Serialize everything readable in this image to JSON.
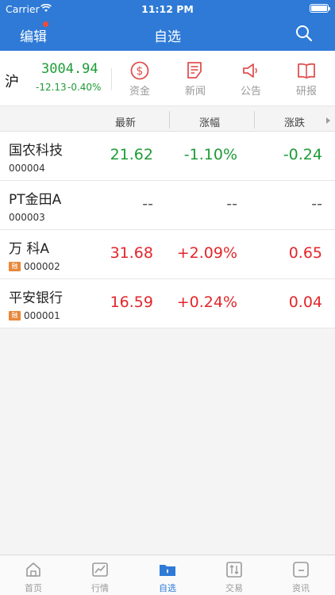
{
  "status_bar": {
    "carrier": "Carrier",
    "time": "11:12 PM"
  },
  "nav": {
    "edit_label": "编辑",
    "title": "自选"
  },
  "index": {
    "name": "沪",
    "value": "3004.94",
    "change": "-12.13",
    "change_pct": "-0.40%"
  },
  "shortcuts": [
    {
      "label": "资金",
      "icon": "dollar-circle-icon"
    },
    {
      "label": "新闻",
      "icon": "news-icon"
    },
    {
      "label": "公告",
      "icon": "megaphone-icon"
    },
    {
      "label": "研报",
      "icon": "book-icon"
    }
  ],
  "columns": {
    "latest": "最新",
    "change_pct": "涨幅",
    "change": "涨跌"
  },
  "stocks": [
    {
      "name": "国农科技",
      "code": "000004",
      "tag": "",
      "price": "21.62",
      "change_pct": "-1.10%",
      "change": "-0.24"
    },
    {
      "name": "PT金田A",
      "code": "000003",
      "tag": "",
      "price": "--",
      "change_pct": "--",
      "change": "--"
    },
    {
      "name": "万  科A",
      "code": "000002",
      "tag": "融",
      "price": "31.68",
      "change_pct": "+2.09%",
      "change": "0.65"
    },
    {
      "name": "平安银行",
      "code": "000001",
      "tag": "融",
      "price": "16.59",
      "change_pct": "+0.24%",
      "change": "0.04"
    }
  ],
  "tabs": [
    {
      "label": "首页",
      "icon": "home-icon"
    },
    {
      "label": "行情",
      "icon": "chart-icon"
    },
    {
      "label": "自选",
      "icon": "folder-icon",
      "active": true
    },
    {
      "label": "交易",
      "icon": "trade-icon"
    },
    {
      "label": "资讯",
      "icon": "info-icon"
    }
  ],
  "colors": {
    "brand": "#2e7ad6",
    "up": "#e3262a",
    "down": "#1d9c36",
    "shortcut_red": "#e05050",
    "tag": "#e8883a"
  }
}
